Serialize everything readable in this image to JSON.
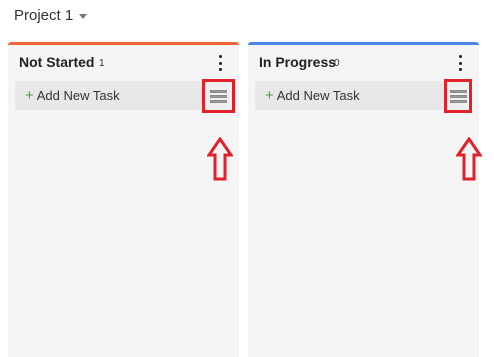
{
  "project": {
    "title": "Project 1"
  },
  "columns": [
    {
      "title": "Not Started",
      "count": "1",
      "accent": "#f0663a",
      "add_task_label": "Add New Task"
    },
    {
      "title": "In Progress",
      "count": "0",
      "accent": "#4a86e8",
      "add_task_label": "Add New Task"
    }
  ],
  "colors": {
    "annotation": "#e0202a",
    "plus": "#5a9e3a"
  },
  "icons": [
    "chevron-down-icon",
    "kebab-menu-icon",
    "plus-icon",
    "list-view-icon",
    "up-arrow-annotation"
  ]
}
